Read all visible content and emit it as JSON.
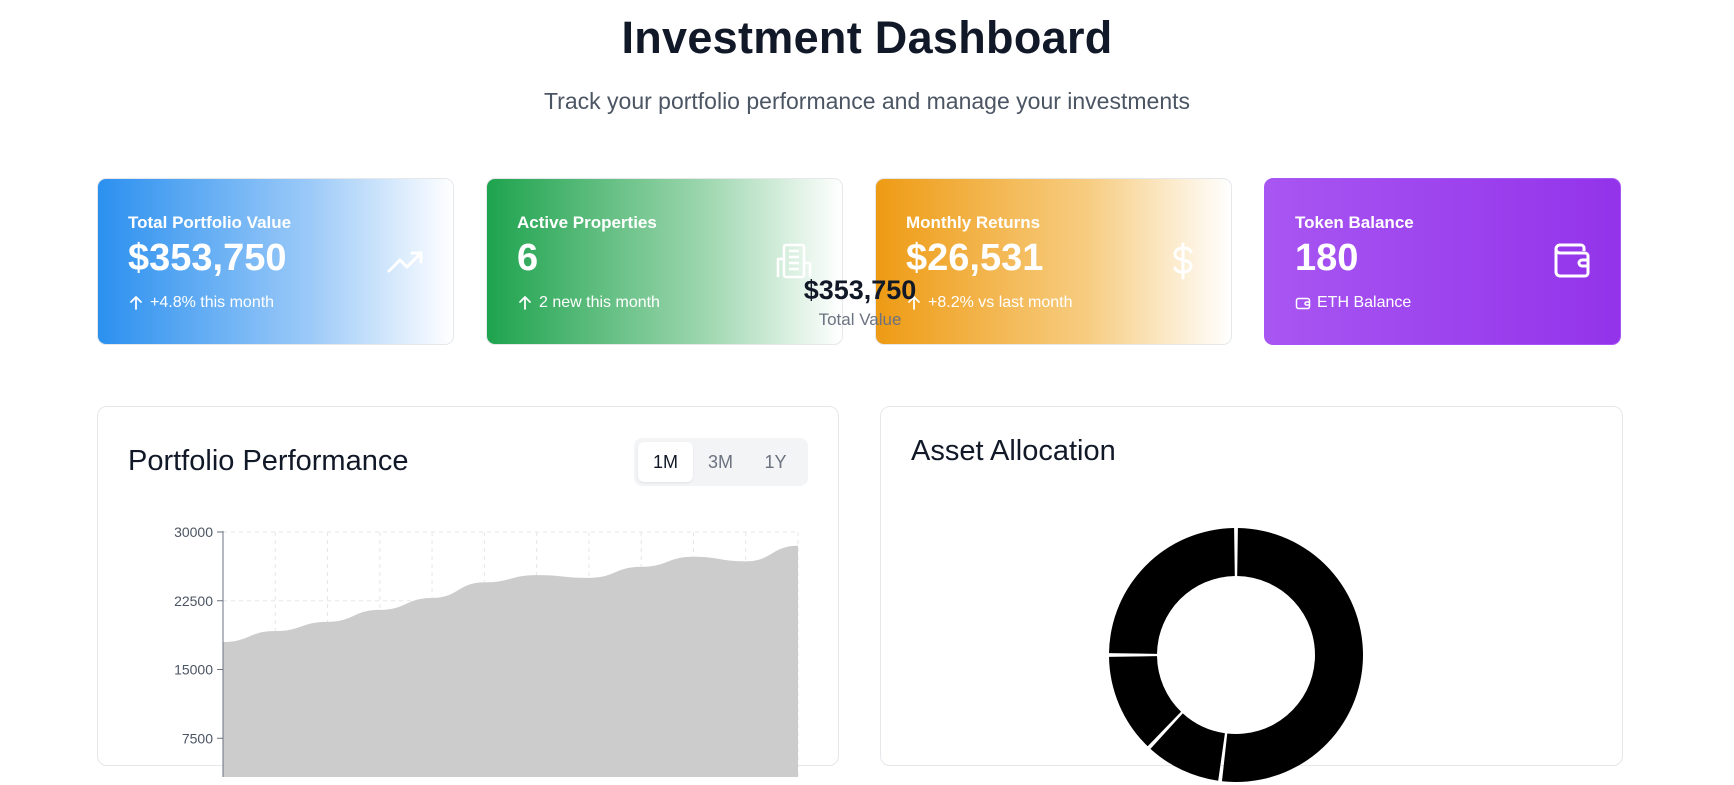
{
  "header": {
    "title": "Investment Dashboard",
    "subtitle": "Track your portfolio performance and manage your investments"
  },
  "stats": [
    {
      "label": "Total Portfolio Value",
      "value": "$353,750",
      "sub": "+4.8% this month",
      "icon": "trending-up-icon"
    },
    {
      "label": "Active Properties",
      "value": "6",
      "sub": "2 new this month",
      "icon": "building-icon"
    },
    {
      "label": "Monthly Returns",
      "value": "$26,531",
      "sub": "+8.2% vs last month",
      "icon": "dollar-icon"
    },
    {
      "label": "Token Balance",
      "value": "180",
      "sub": "ETH Balance",
      "icon": "wallet-icon"
    }
  ],
  "tooltip": {
    "value": "$353,750",
    "label": "Total Value"
  },
  "performance": {
    "title": "Portfolio Performance",
    "ranges": [
      "1M",
      "3M",
      "1Y"
    ],
    "active_range": "1M"
  },
  "allocation": {
    "title": "Asset Allocation"
  },
  "chart_data": [
    {
      "type": "area",
      "title": "Portfolio Performance",
      "yticks": [
        7500,
        15000,
        22500,
        30000
      ],
      "ylim": [
        0,
        30000
      ],
      "x": [
        0,
        1,
        2,
        3,
        4,
        5,
        6,
        7,
        8,
        9,
        10,
        11
      ],
      "values": [
        18000,
        19200,
        20200,
        21500,
        22800,
        24500,
        25300,
        25000,
        26200,
        27300,
        26800,
        28500
      ],
      "grid": true,
      "fill_color": "#cccccc"
    },
    {
      "type": "pie",
      "title": "Asset Allocation",
      "values": [
        52,
        10,
        13,
        25
      ],
      "colors": [
        "#000000",
        "#000000",
        "#000000",
        "#000000"
      ]
    }
  ]
}
